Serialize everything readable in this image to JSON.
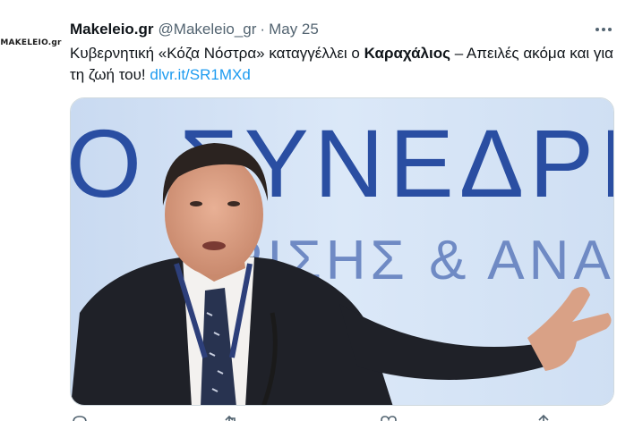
{
  "tweet": {
    "avatar_text": "MAKELEIO.gr",
    "display_name": "Makeleio.gr",
    "handle": "@Makeleio_gr",
    "separator": "·",
    "date": "May 25",
    "text_part1": "Κυβερνητική «Κόζα Νόστρα» καταγγέλλει ο ",
    "text_bold": "Καραχάλιος",
    "text_part2": " – Απειλές ακόμα και για τη ζωή του! ",
    "link": "dlvr.it/SR1MXd"
  },
  "media": {
    "banner_line1": "Ο ΣΥΝΕΔΡΙ",
    "banner_line2": "ΤΡΙΣΗΣ & ΑΝΑΠΤΥ",
    "icon": "photo-of-man-speaking"
  },
  "actions": [
    "reply-icon",
    "retweet-icon",
    "like-icon",
    "share-icon"
  ],
  "colors": {
    "link": "#1d9bf0",
    "secondary_text": "#536471",
    "primary_text": "#0f1419",
    "banner_text": "#2a4ea2"
  }
}
